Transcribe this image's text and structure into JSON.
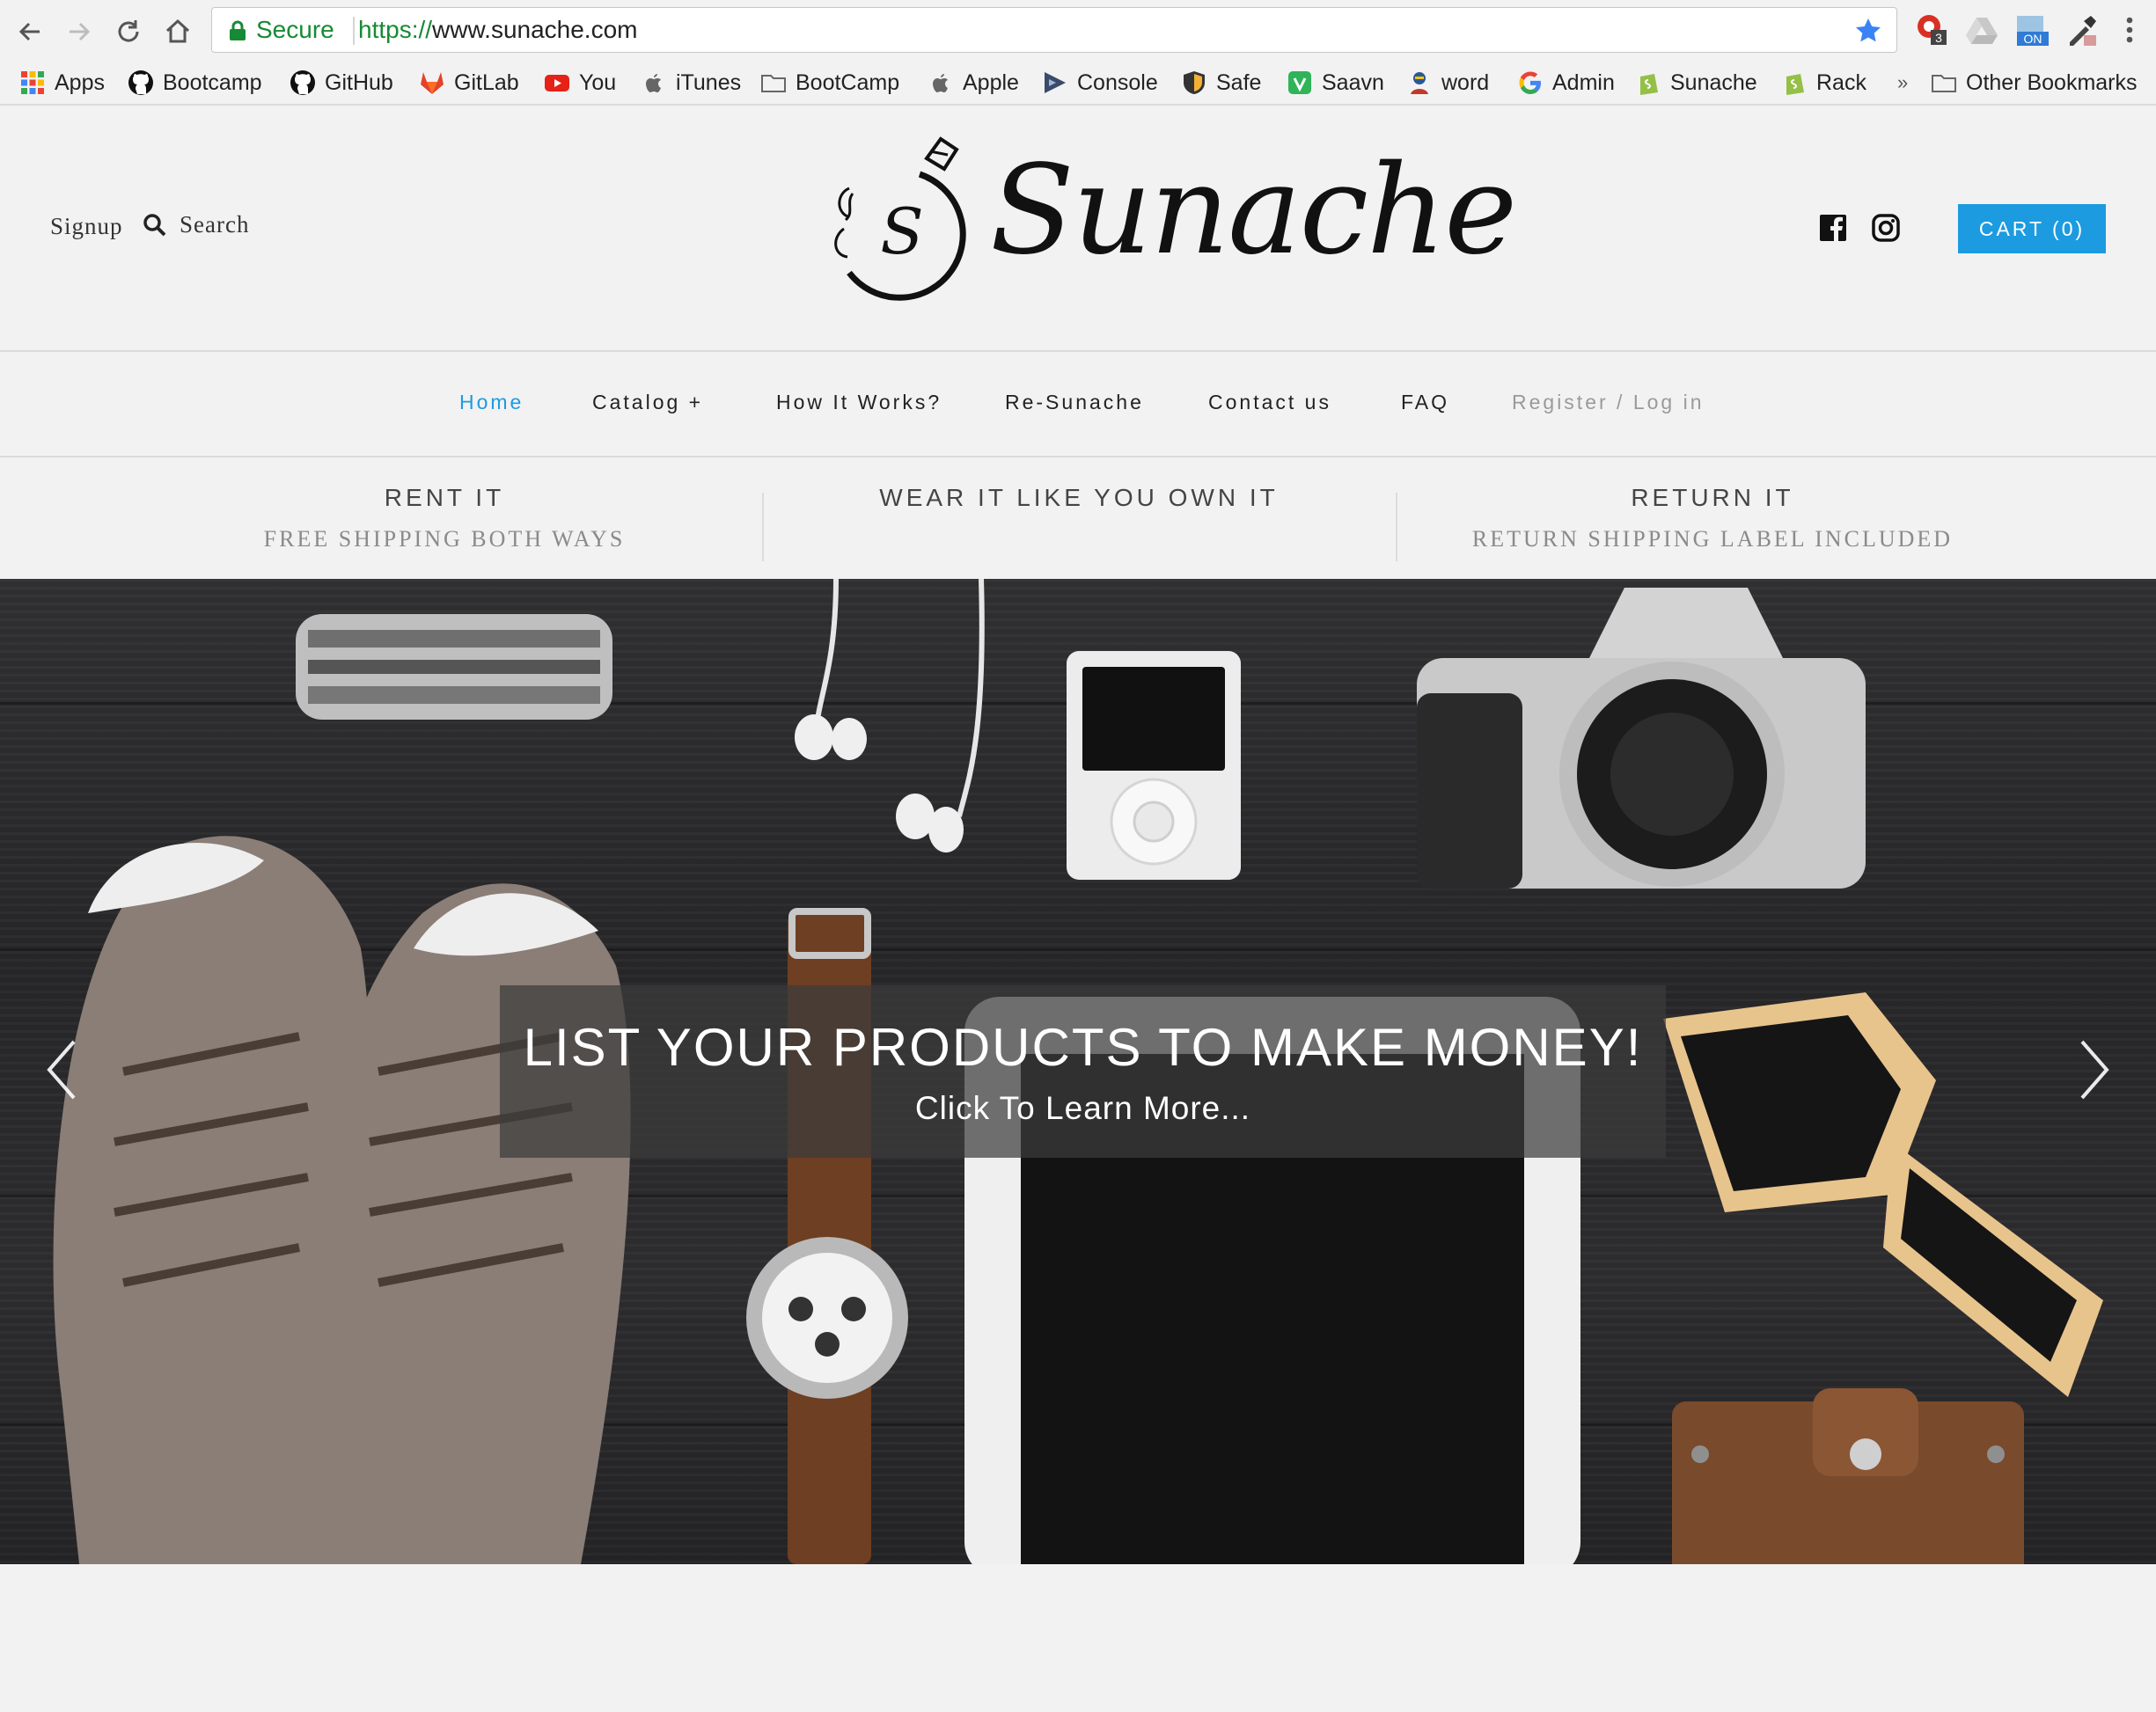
{
  "browser": {
    "secure_label": "Secure",
    "url_scheme": "https://",
    "url_rest": "www.sunache.com",
    "extension_badge_count": "3",
    "extension_toggle_label": "ON",
    "bookmarks": [
      {
        "label": "Apps",
        "icon": "apps-grid-icon"
      },
      {
        "label": "Bootcamp",
        "icon": "github-icon"
      },
      {
        "label": "GitHub",
        "icon": "github-icon"
      },
      {
        "label": "GitLab",
        "icon": "gitlab-icon"
      },
      {
        "label": "You",
        "icon": "youtube-icon"
      },
      {
        "label": "iTunes",
        "icon": "apple-icon"
      },
      {
        "label": "BootCamp",
        "icon": "folder-icon"
      },
      {
        "label": "Apple",
        "icon": "apple-icon"
      },
      {
        "label": "Console",
        "icon": "console-icon"
      },
      {
        "label": "Safe",
        "icon": "shield-icon"
      },
      {
        "label": "Saavn",
        "icon": "saavn-icon"
      },
      {
        "label": "word",
        "icon": "word-icon"
      },
      {
        "label": "Admin",
        "icon": "google-icon"
      },
      {
        "label": "Sunache",
        "icon": "shopify-icon"
      },
      {
        "label": "Rack",
        "icon": "shopify-icon"
      }
    ],
    "overflow_label": "»",
    "other_bookmarks": "Other Bookmarks"
  },
  "header": {
    "signup": "Signup",
    "search": "Search",
    "logo_letter": "S",
    "logo_word": "Sunache",
    "cart_label": "CART (0)"
  },
  "nav": {
    "items": [
      {
        "label": "Home",
        "state": "active"
      },
      {
        "label": "Catalog +",
        "state": "normal"
      },
      {
        "label": "How It Works?",
        "state": "normal"
      },
      {
        "label": "Re-Sunache",
        "state": "normal"
      },
      {
        "label": "Contact us",
        "state": "normal"
      },
      {
        "label": "FAQ",
        "state": "normal"
      },
      {
        "label": "Register / Log in",
        "state": "muted"
      }
    ]
  },
  "promo": [
    {
      "title": "RENT IT",
      "subtitle": "FREE SHIPPING BOTH WAYS"
    },
    {
      "title": "WEAR IT LIKE YOU OWN IT",
      "subtitle": ""
    },
    {
      "title": "RETURN IT",
      "subtitle": "RETURN SHIPPING LABEL INCLUDED"
    }
  ],
  "hero": {
    "headline": "LIST YOUR PRODUCTS TO MAKE MONEY!",
    "subline": "Click To Learn More..."
  },
  "colors": {
    "accent": "#1c9be0",
    "secure_green": "#178a35",
    "page_bg": "#f2f2f2"
  }
}
